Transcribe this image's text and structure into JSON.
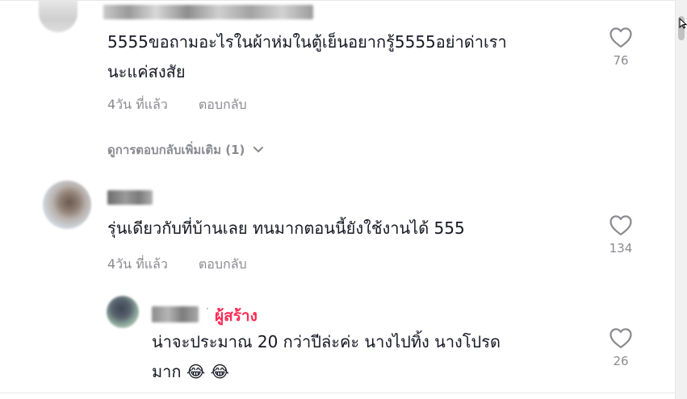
{
  "comments": [
    {
      "text_line1": "5555ขอถามอะไรในผ้าห่มในตู้เย็นอยากรู้5555อย่าด่าเรา",
      "text_line2": "นะแค่สงสัย",
      "time": "4วัน ที่แล้ว",
      "reply_label": "ตอบกลับ",
      "likes": "76",
      "more_replies": "ดูการตอบกลับเพิ่มเติม (1)"
    },
    {
      "text": "รุ่นเดียวกับที่บ้านเลย ทนมากตอนนี้ยังใช้งานได้ 555",
      "time": "4วัน ที่แล้ว",
      "reply_label": "ตอบกลับ",
      "likes": "134"
    }
  ],
  "reply": {
    "creator_tag": "ผู้สร้าง",
    "text_line1": "น่าจะประมาณ 20 กว่าปีล่ะค่ะ นางไปทิ้ง นางโปรด",
    "text_line2": "มาก 😂 😂",
    "likes": "26"
  },
  "icons": {
    "like": "heart-outline-icon",
    "expand": "chevron-down-icon",
    "cursor": "mouse-cursor-icon"
  },
  "colors": {
    "creator": "#fe2c55",
    "meta": "#8a8b91",
    "text": "#161823"
  }
}
